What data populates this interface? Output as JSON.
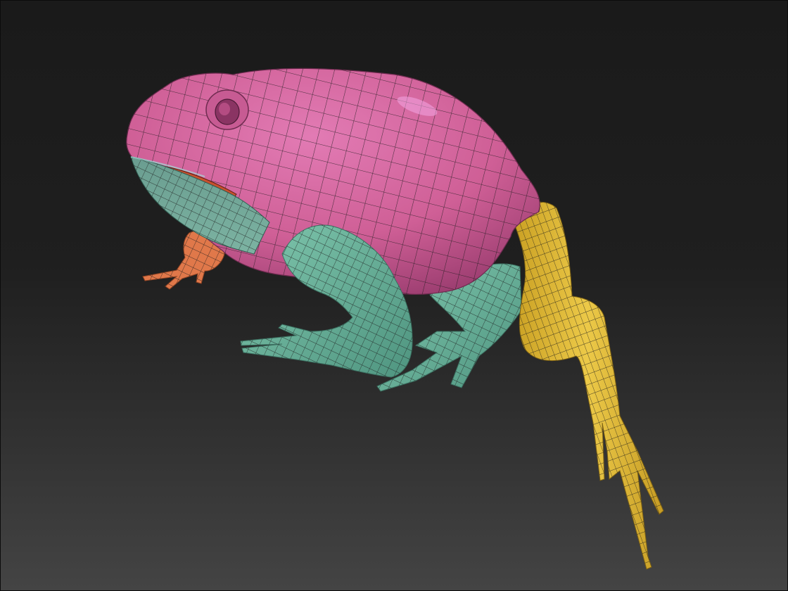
{
  "viewport": {
    "background_top": "#1a1a1a",
    "background_bottom": "#444444"
  },
  "model": {
    "subject": "frog-polygroups",
    "wireframe_color": "#1b1b1b",
    "polygroups": [
      {
        "name": "body",
        "color": "#d2649d"
      },
      {
        "name": "throat-and-front-leg",
        "color": "#6fb59e"
      },
      {
        "name": "hind-leg",
        "color": "#e2bd3c"
      },
      {
        "name": "left-front-foot",
        "color": "#e0784a"
      },
      {
        "name": "mouth-interior",
        "color": "#c8502e"
      }
    ]
  }
}
